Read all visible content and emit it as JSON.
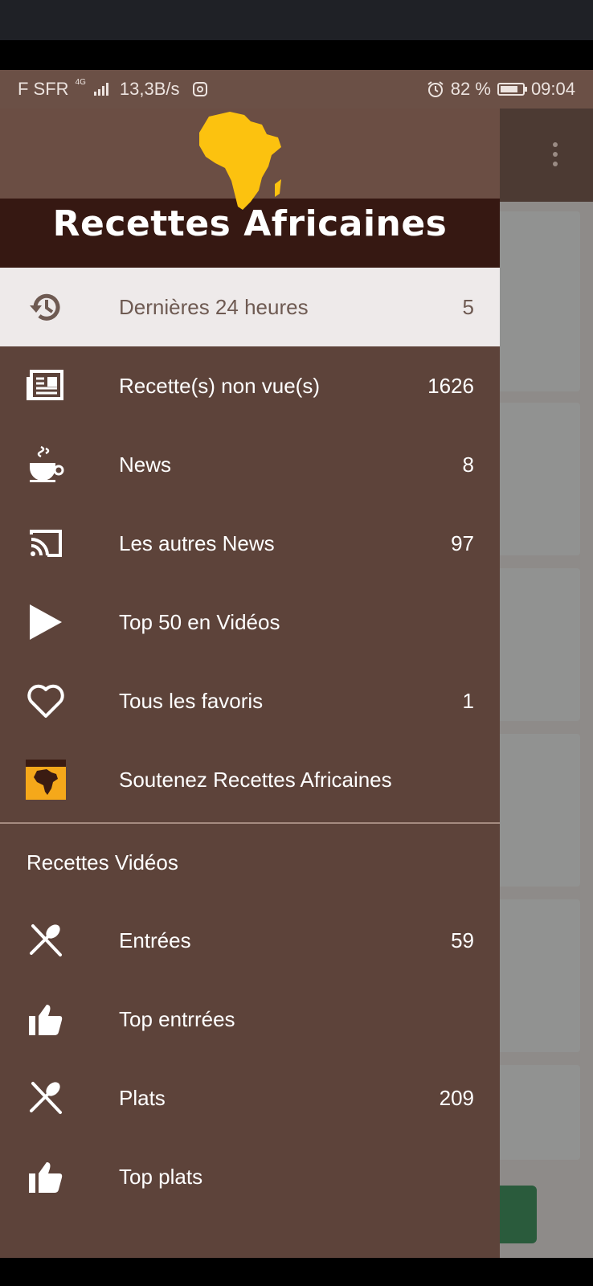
{
  "status_bar": {
    "carrier": "F SFR",
    "network_type": "4G",
    "speed": "13,3B/s",
    "battery": "82 %",
    "battery_level": 0.82,
    "time": "09:04"
  },
  "drawer": {
    "brand_title": "Recettes Africaines",
    "items": [
      {
        "icon": "history-icon",
        "label": "Dernières 24 heures",
        "count": "5",
        "selected": true
      },
      {
        "icon": "newspaper-icon",
        "label": "Recette(s) non vue(s)",
        "count": "1626"
      },
      {
        "icon": "coffee-cup-icon",
        "label": "News",
        "count": "8"
      },
      {
        "icon": "cast-icon",
        "label": "Les autres News",
        "count": "97"
      },
      {
        "icon": "play-icon",
        "label": "Top 50 en Vidéos",
        "count": ""
      },
      {
        "icon": "heart-icon",
        "label": "Tous les favoris",
        "count": "1"
      },
      {
        "icon": "app-logo-icon",
        "label": "Soutenez Recettes Africaines",
        "count": ""
      }
    ],
    "section_title": "Recettes Vidéos",
    "video_items": [
      {
        "icon": "utensils-icon",
        "label": "Entrées",
        "count": "59"
      },
      {
        "icon": "thumbs-up-icon",
        "label": "Top entrrées",
        "count": ""
      },
      {
        "icon": "utensils-icon",
        "label": "Plats",
        "count": "209"
      },
      {
        "icon": "thumbs-up-icon",
        "label": "Top plats",
        "count": ""
      }
    ]
  },
  "colors": {
    "drawer_bg": "#5d433a",
    "header_band": "#361812",
    "selected_bg": "#eeeaea",
    "africa_yellow": "#fcc20f",
    "status_bar": "#6b5046"
  }
}
